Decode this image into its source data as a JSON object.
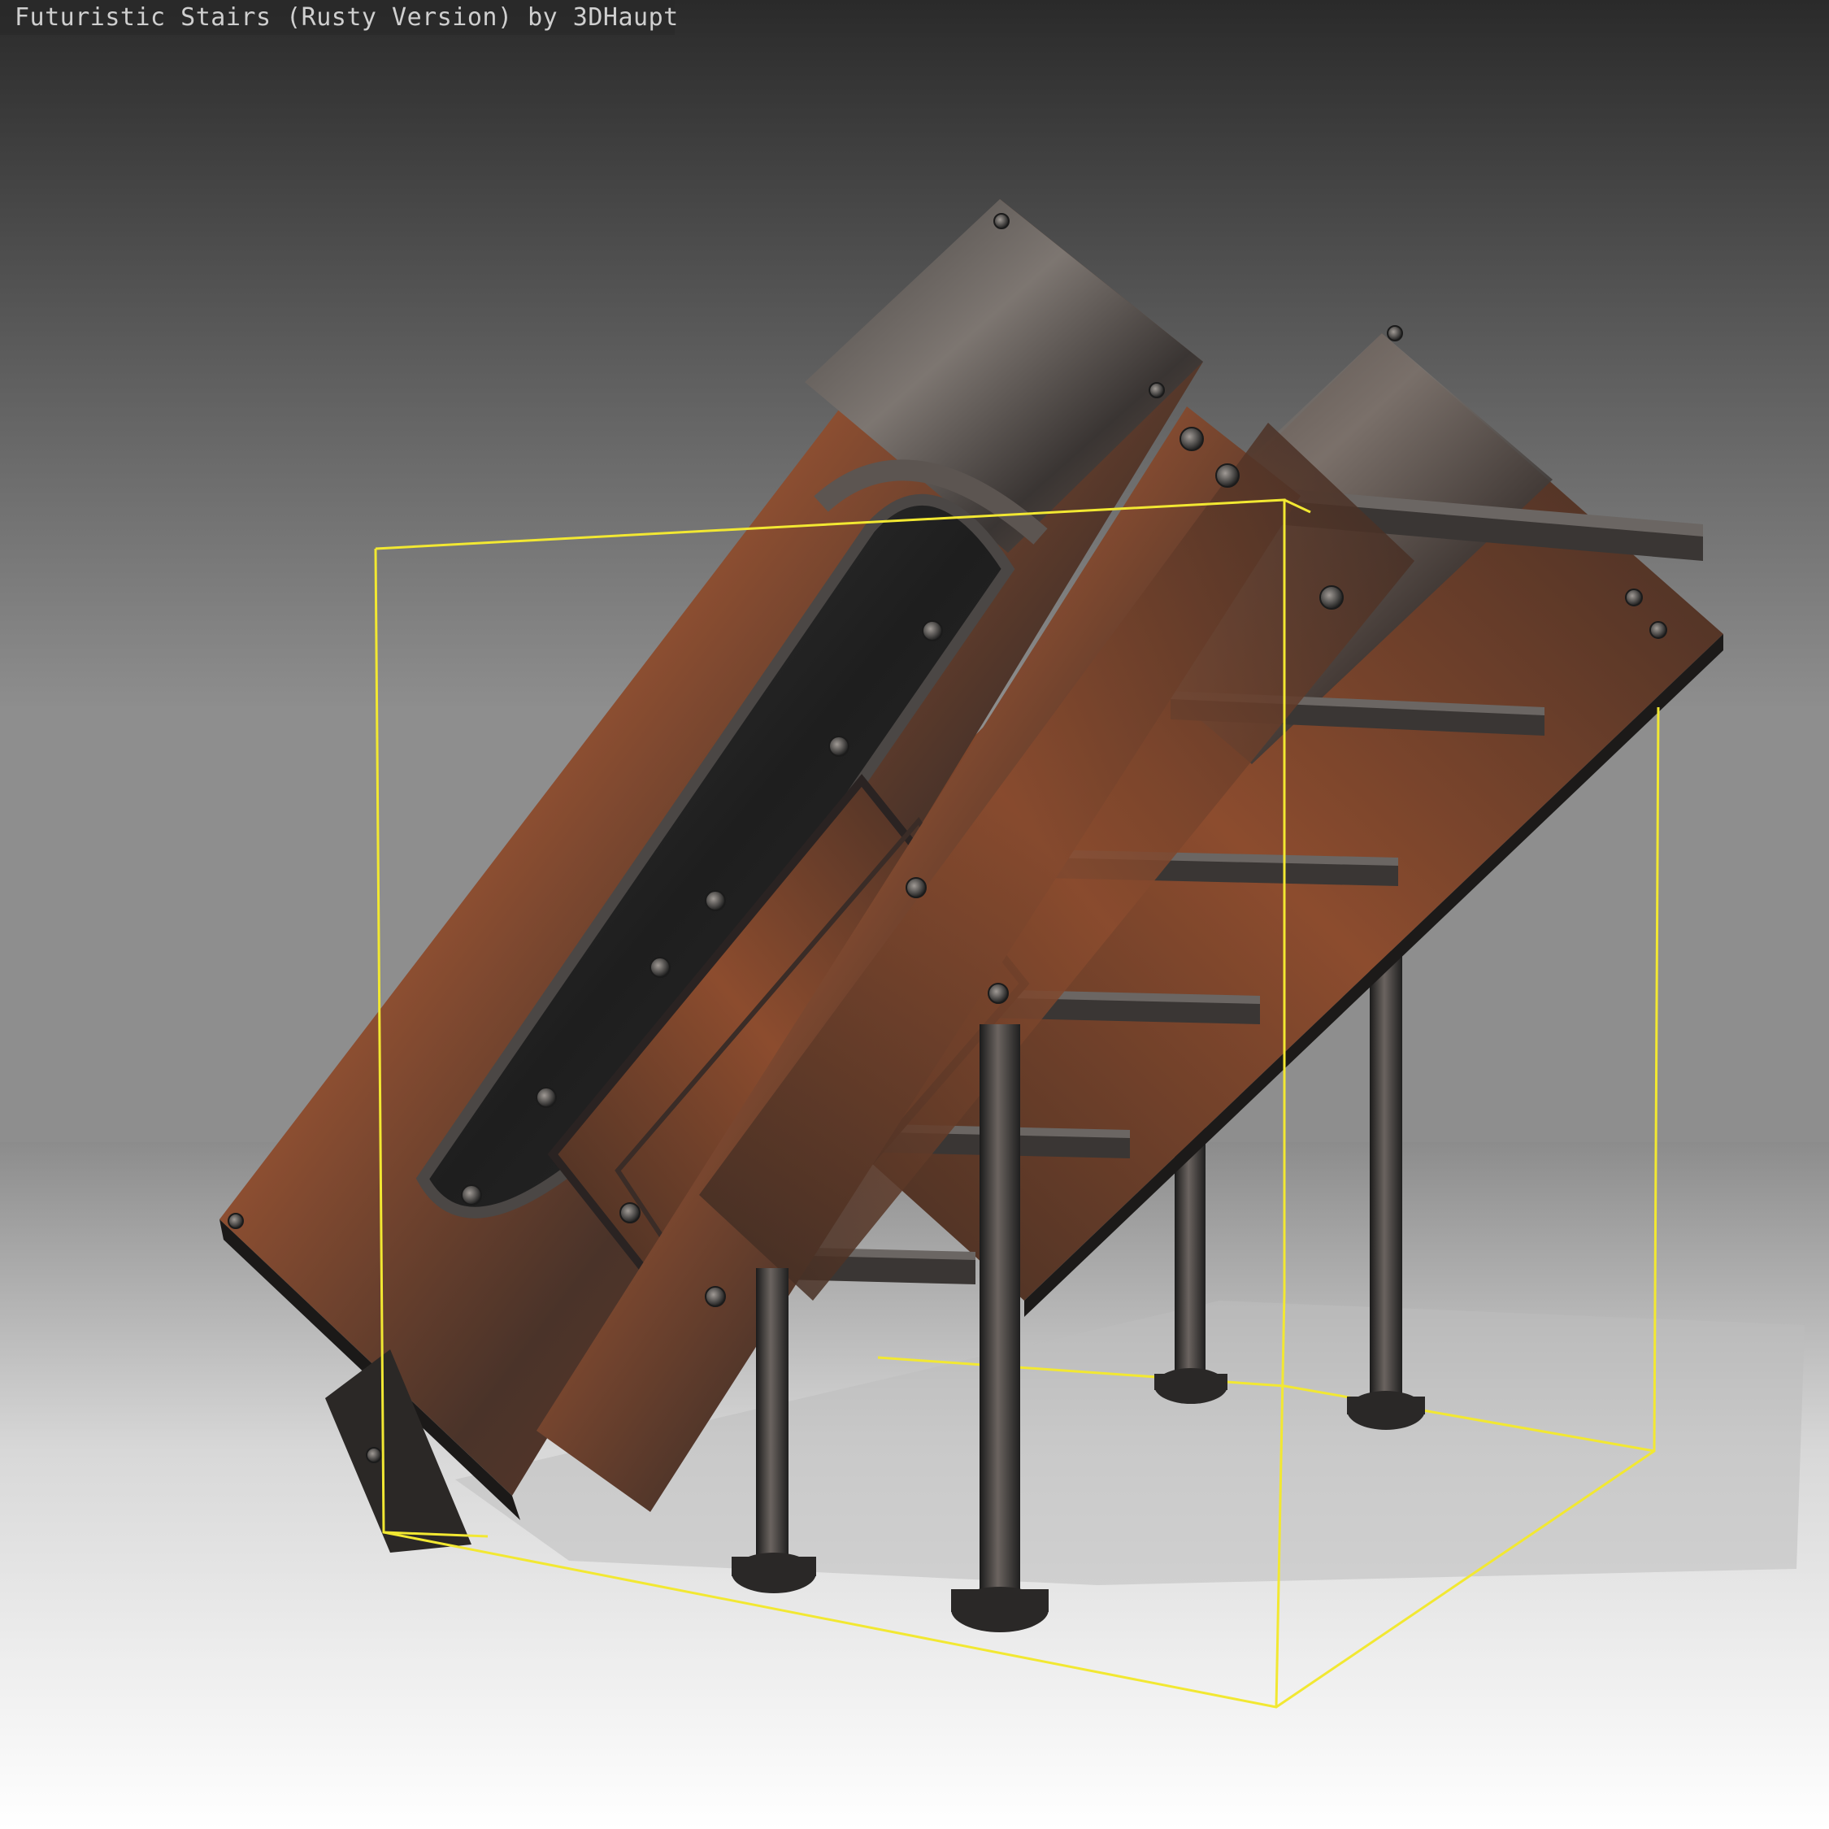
{
  "viewer": {
    "title": "Futuristic Stairs (Rusty Version) by 3DHaupt"
  },
  "scene": {
    "object": "futuristic-stairs",
    "selection_outline_color": "#f2e832",
    "material_colors": {
      "rust": "#8a4a2c",
      "dark_metal": "#2b2a29",
      "steel": "#6d6a67"
    },
    "background_colors": {
      "top": "#2a2a2a",
      "bottom": "#ffffff"
    }
  }
}
